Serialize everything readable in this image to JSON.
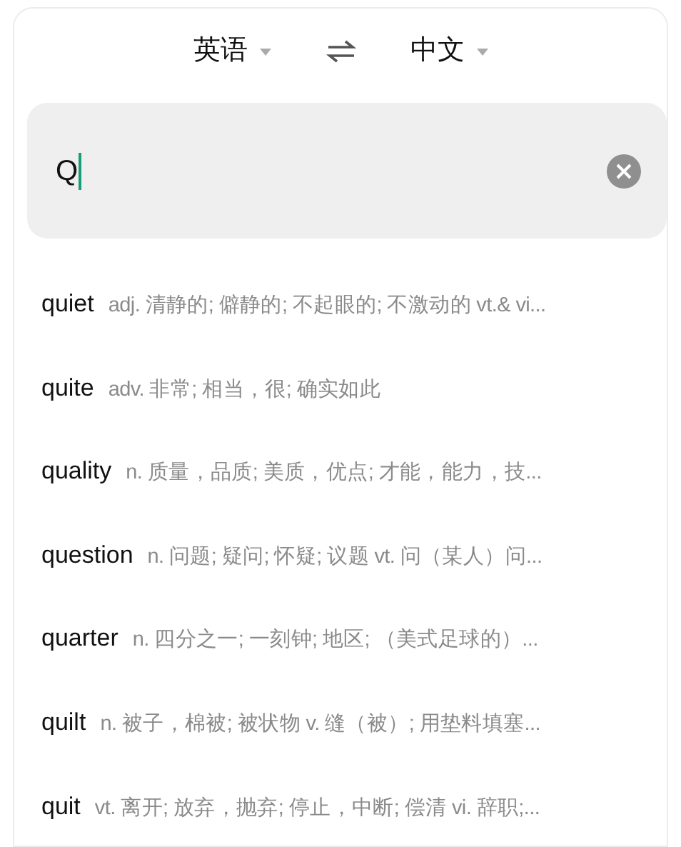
{
  "languages": {
    "source": "英语",
    "target": "中文"
  },
  "search": {
    "value": "Q"
  },
  "suggestions": [
    {
      "word": "quiet",
      "definition": "adj. 清静的; 僻静的; 不起眼的; 不激动的 vt.& vi..."
    },
    {
      "word": "quite",
      "definition": "adv. 非常; 相当，很; 确实如此"
    },
    {
      "word": "quality",
      "definition": "n. 质量，品质; 美质，优点; 才能，能力，技..."
    },
    {
      "word": "question",
      "definition": "n. 问题; 疑问; 怀疑; 议题 vt. 问（某人）问..."
    },
    {
      "word": "quarter",
      "definition": "n. 四分之一; 一刻钟; 地区; （美式足球的）..."
    },
    {
      "word": "quilt",
      "definition": "n. 被子，棉被; 被状物 v. 缝（被）; 用垫料填塞..."
    },
    {
      "word": "quit",
      "definition": "vt. 离开; 放弃，抛弃; 停止，中断; 偿清 vi. 辞职;..."
    }
  ]
}
